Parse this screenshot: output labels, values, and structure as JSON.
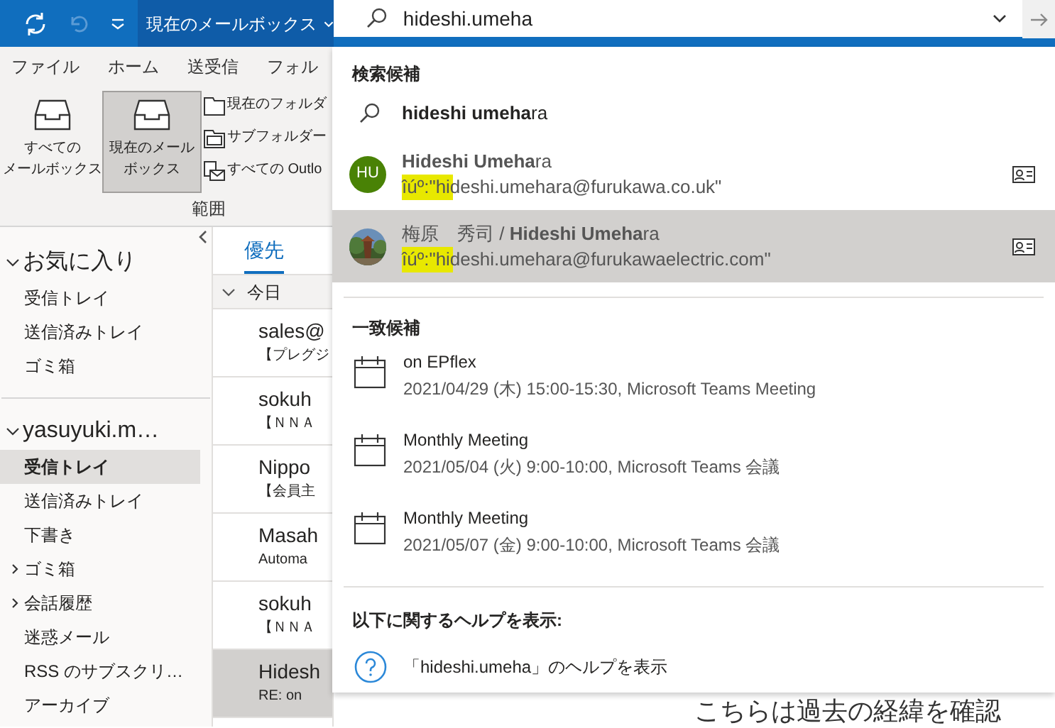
{
  "toolbar": {
    "mailbox_scope": "現在のメールボックス"
  },
  "search": {
    "value": "hideshi.umeha"
  },
  "ribbon_tabs": [
    {
      "label": "ファイル"
    },
    {
      "label": "ホーム"
    },
    {
      "label": "送受信"
    },
    {
      "label": "フォル"
    }
  ],
  "ribbon": {
    "scope_buttons": [
      {
        "lines": [
          "すべての",
          "メールボックス"
        ],
        "selected": false
      },
      {
        "lines": [
          "現在のメール",
          "ボックス"
        ],
        "selected": true
      }
    ],
    "small_buttons": [
      {
        "label": "現在のフォルダ",
        "kind": "folder"
      },
      {
        "label": "サブフォルダー",
        "kind": "subfolder"
      },
      {
        "label": "すべての Outlo",
        "kind": "all"
      }
    ],
    "group_label": "範囲"
  },
  "folder_pane": {
    "sections": [
      {
        "label": "お気に入り",
        "expanded": true,
        "children": [
          {
            "label": "受信トレイ",
            "selected": false,
            "has_subfolders": false
          },
          {
            "label": "送信済みトレイ",
            "selected": false,
            "has_subfolders": false
          },
          {
            "label": "ゴミ箱",
            "selected": false,
            "has_subfolders": false
          }
        ]
      },
      {
        "label": "yasuyuki.m…",
        "expanded": true,
        "children": [
          {
            "label": "受信トレイ",
            "selected": true,
            "has_subfolders": false
          },
          {
            "label": "送信済みトレイ",
            "selected": false,
            "has_subfolders": false
          },
          {
            "label": "下書き",
            "selected": false,
            "has_subfolders": false
          },
          {
            "label": "ゴミ箱",
            "selected": false,
            "has_subfolders": true
          },
          {
            "label": "会話履歴",
            "selected": false,
            "has_subfolders": true
          },
          {
            "label": "迷惑メール",
            "selected": false,
            "has_subfolders": false
          },
          {
            "label": "RSS のサブスクリ…",
            "selected": false,
            "has_subfolders": false
          },
          {
            "label": "アーカイブ",
            "selected": false,
            "has_subfolders": false
          }
        ]
      }
    ]
  },
  "message_list": {
    "tabs": [
      {
        "label": "優先",
        "selected": true
      }
    ],
    "group": "今日",
    "messages": [
      {
        "sender": "sales@",
        "preview": "【プレグジ",
        "selected": false
      },
      {
        "sender": "sokuh",
        "preview": "【ＮＮＡ",
        "selected": false
      },
      {
        "sender": "Nippo",
        "preview": "【会員主",
        "selected": false
      },
      {
        "sender": "Masah",
        "preview": "Automa",
        "selected": false
      },
      {
        "sender": "sokuh",
        "preview": "【ＮＮＡ",
        "selected": false
      },
      {
        "sender": "Hidesh",
        "preview": "RE: on",
        "selected": true
      }
    ]
  },
  "reading_pane": {
    "text": "こちらは過去の経緯を確認"
  },
  "suggestions": {
    "heading": "検索候補",
    "query": "**hideshi umeha**ra",
    "people": [
      {
        "kind": "initials",
        "initials": "HU",
        "name": "**Hideshi Umeha**ra",
        "email": "îúº:\"hideshi.umehara@furukawa.co.uk\"",
        "selected": false,
        "highlighted": true
      },
      {
        "kind": "picture",
        "name": "梅原　秀司 / **Hideshi Umeha**ra",
        "email": "îúº:\"hideshi.umehara@furukawaelectric.com\"",
        "selected": true,
        "highlighted": true
      }
    ]
  },
  "matches": {
    "heading": "一致候補",
    "events": [
      {
        "title": "on EPflex",
        "detail": "2021/04/29 (木) 15:00-15:30, Microsoft Teams Meeting"
      },
      {
        "title": "Monthly Meeting",
        "detail": "2021/05/04 (火) 9:00-10:00, Microsoft Teams 会議"
      },
      {
        "title": "Monthly Meeting",
        "detail": "2021/05/07 (金) 9:00-10:00, Microsoft Teams 会議"
      }
    ]
  },
  "help": {
    "heading": "以下に関するヘルプを表示:",
    "link": "「hideshi.umeha」のヘルプを表示"
  }
}
